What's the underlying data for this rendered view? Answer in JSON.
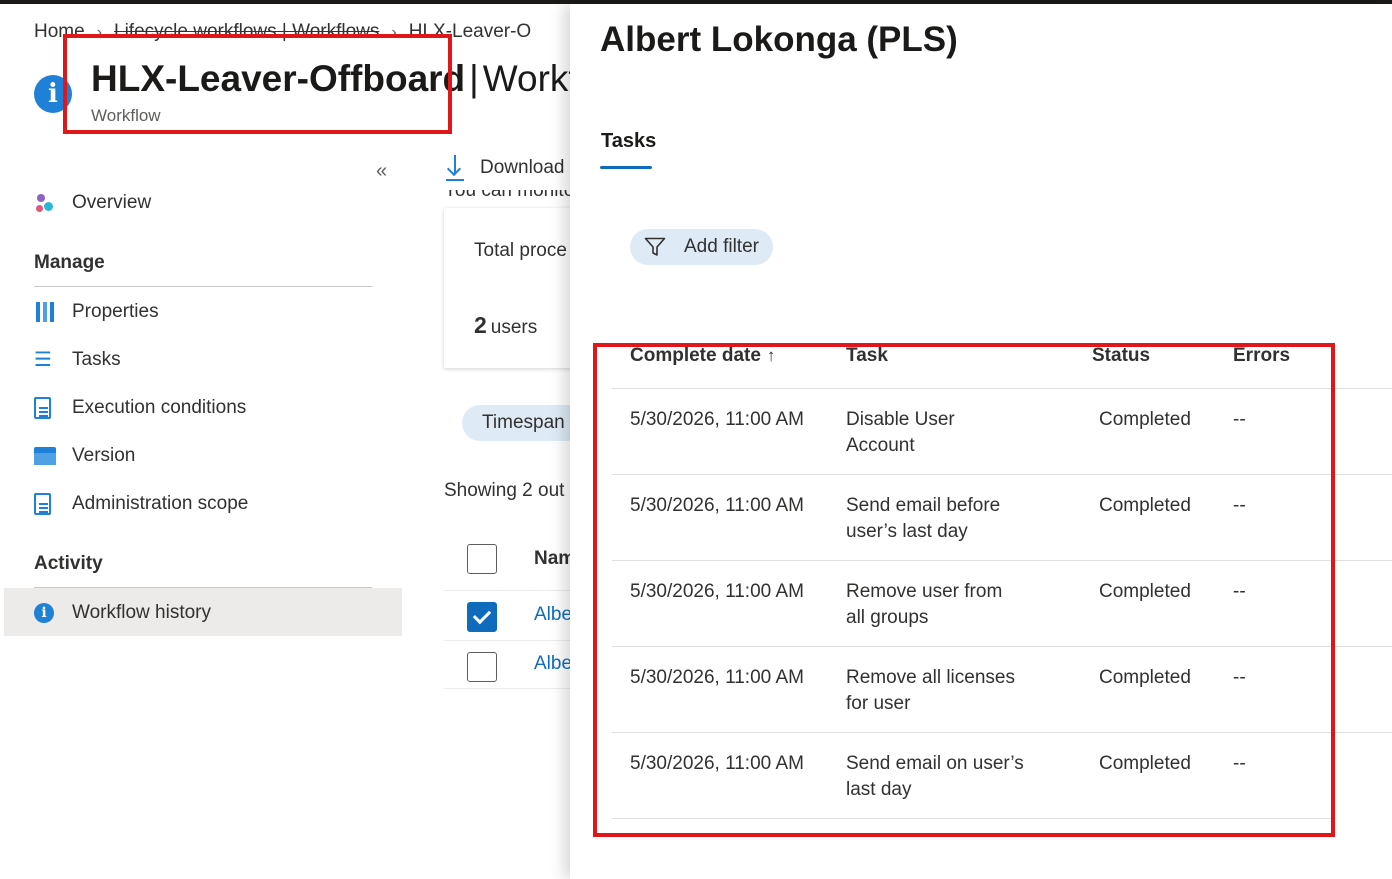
{
  "breadcrumb": {
    "items": [
      "Home",
      "Lifecycle workflows | Workflows",
      "HLX-Leaver-O"
    ]
  },
  "page": {
    "title_main": "HLX-Leaver-Offboard",
    "title_separator": "|",
    "title_rest": "Workfl",
    "subtitle": "Workflow"
  },
  "sidebar": {
    "collapse_glyph": "«",
    "overview": "Overview",
    "manage_header": "Manage",
    "manage_items": [
      "Properties",
      "Tasks",
      "Execution conditions",
      "Version",
      "Administration scope"
    ],
    "activity_header": "Activity",
    "activity_items": [
      "Workflow history"
    ]
  },
  "main": {
    "download_label": "Download",
    "monitor_text": "You can monito",
    "card_label": "Total proce",
    "card_value_number": "2",
    "card_value_unit": "users",
    "timespan_label": "Timespan",
    "showing_text": "Showing 2 out",
    "name_column": "Nam",
    "rows": [
      {
        "name": "Albe",
        "checked": true
      },
      {
        "name": "Albe",
        "checked": false
      }
    ]
  },
  "panel": {
    "title": "Albert Lokonga (PLS)",
    "tab_label": "Tasks",
    "add_filter_label": "Add filter",
    "columns": {
      "date": "Complete date",
      "date_sort_glyph": "↑",
      "task": "Task",
      "status": "Status",
      "errors": "Errors"
    },
    "rows": [
      {
        "date": "5/30/2026, 11:00 AM",
        "task_line1": "Disable User",
        "task_line2": "Account",
        "status": "Completed",
        "errors": "--"
      },
      {
        "date": "5/30/2026, 11:00 AM",
        "task_line1": "Send email before",
        "task_line2": "user’s last day",
        "status": "Completed",
        "errors": "--"
      },
      {
        "date": "5/30/2026, 11:00 AM",
        "task_line1": "Remove user from",
        "task_line2": "all groups",
        "status": "Completed",
        "errors": "--"
      },
      {
        "date": "5/30/2026, 11:00 AM",
        "task_line1": "Remove all licenses",
        "task_line2": "for user",
        "status": "Completed",
        "errors": "--"
      },
      {
        "date": "5/30/2026, 11:00 AM",
        "task_line1": "Send email on user’s",
        "task_line2": "last day",
        "status": "Completed",
        "errors": "--"
      }
    ]
  },
  "colors": {
    "accent": "#0f6cbd",
    "highlight_box": "#e0161b",
    "selected_nav": "#edebe9",
    "pill_bg": "#dfeaf7"
  },
  "icons": {
    "title": "info-icon",
    "overview": "overview-icon",
    "properties": "properties-icon",
    "tasks": "tasks-icon",
    "execution_conditions": "document-icon",
    "version": "version-icon",
    "administration_scope": "document-icon",
    "workflow_history": "info-icon",
    "download": "download-icon",
    "filter": "filter-icon"
  }
}
